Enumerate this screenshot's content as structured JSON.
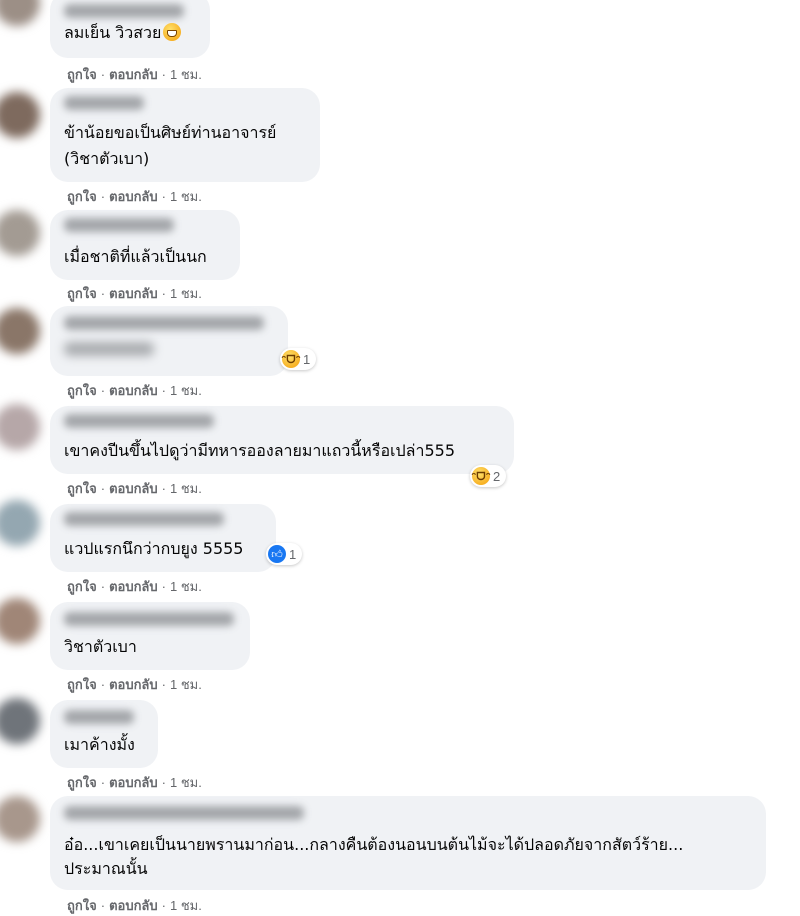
{
  "actions": {
    "like": "ถูกใจ",
    "reply": "ตอบกลับ",
    "separator": "·",
    "time": "1 ชม."
  },
  "comments": [
    {
      "lines": [
        "ลมเย็น วิวสวย"
      ],
      "emoji": "grinning-face",
      "reaction": null
    },
    {
      "lines": [
        "ข้าน้อยขอเป็นศิษย์ท่านอาจารย์",
        "(วิชาตัวเบา)"
      ],
      "reaction": null
    },
    {
      "lines": [
        "เมื่อชาติที่แล้วเป็นนก"
      ],
      "reaction": null
    },
    {
      "lines": [],
      "reaction": {
        "icon": "haha-icon",
        "count": "1"
      }
    },
    {
      "lines": [
        "เขาคงปีนขึ้นไปดูว่ามีทหารอองลายมาแถวนี้หรือเปล่า555"
      ],
      "reaction": {
        "icon": "haha-icon",
        "count": "2"
      }
    },
    {
      "lines": [
        "แวปแรกนึกว่ากบยูง 5555"
      ],
      "reaction": {
        "icon": "like-icon",
        "count": "1"
      }
    },
    {
      "lines": [
        "วิชาตัวเบา"
      ],
      "reaction": null
    },
    {
      "lines": [
        "เมาค้างมั้ง"
      ],
      "reaction": null
    },
    {
      "lines": [
        "อ๋อ...เขาเคยเป็นนายพรานมาก่อน...กลางคืนต้องนอนบนต้นไม้จะได้ปลอดภัยจากสัตว์ร้าย...",
        "ประมาณนั้น"
      ],
      "reaction": null
    }
  ],
  "colors": {
    "bubble": "#f0f2f5",
    "text": "#050505",
    "meta": "#65676b",
    "like_blue": "#1877f2",
    "haha_yellow": "#f7b125"
  }
}
